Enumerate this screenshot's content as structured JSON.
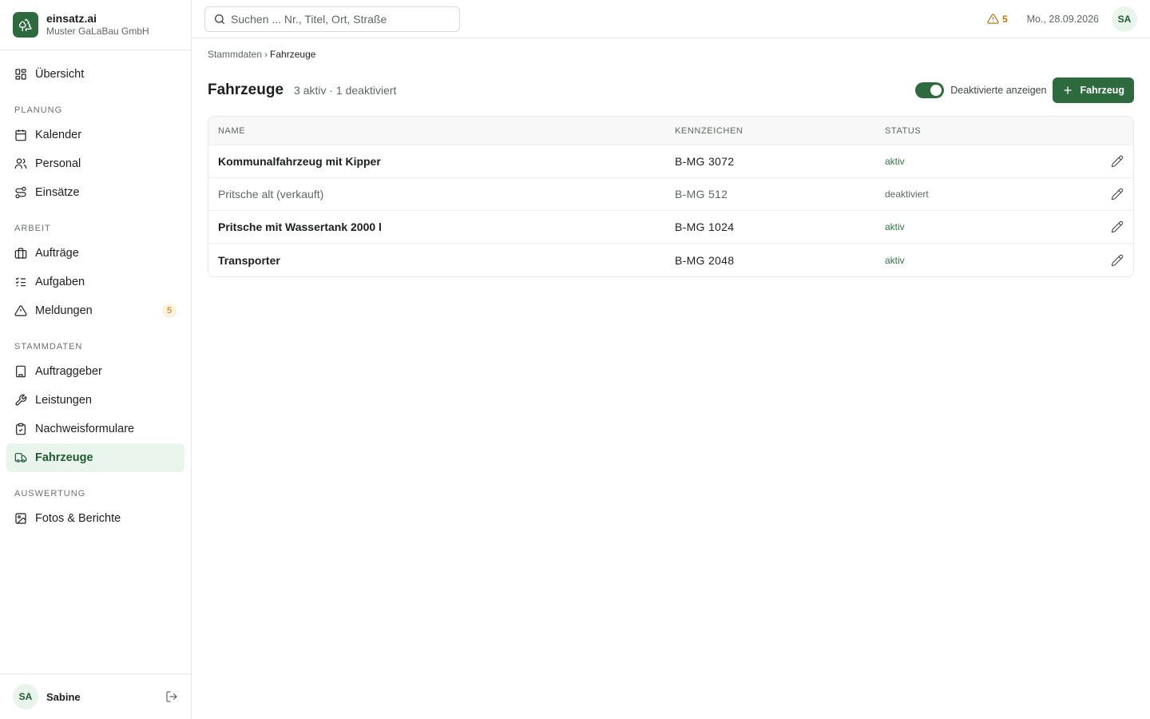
{
  "brand": {
    "name": "einsatz.ai",
    "org": "Muster GaLaBau GmbH",
    "accent": "#2d6a3e"
  },
  "sidebar": {
    "items": [
      {
        "label": "Übersicht",
        "icon": "grid-icon"
      },
      {
        "section": "PLANUNG"
      },
      {
        "label": "Kalender",
        "icon": "calendar-icon"
      },
      {
        "label": "Personal",
        "icon": "users-icon"
      },
      {
        "label": "Einsätze",
        "icon": "route-icon"
      },
      {
        "section": "ARBEIT"
      },
      {
        "label": "Aufträge",
        "icon": "briefcase-icon"
      },
      {
        "label": "Aufgaben",
        "icon": "checklist-icon"
      },
      {
        "label": "Meldungen",
        "icon": "warning-icon",
        "badge": "5"
      },
      {
        "section": "STAMMDATEN"
      },
      {
        "label": "Auftraggeber",
        "icon": "building-icon"
      },
      {
        "label": "Leistungen",
        "icon": "wrench-icon"
      },
      {
        "label": "Nachweisformulare",
        "icon": "clipboard-icon"
      },
      {
        "label": "Fahrzeuge",
        "icon": "truck-icon",
        "active": true
      },
      {
        "section": "AUSWERTUNG"
      },
      {
        "label": "Fotos & Berichte",
        "icon": "image-icon"
      }
    ]
  },
  "user": {
    "initials": "SA",
    "name": "Sabine"
  },
  "header": {
    "search_placeholder": "Suchen ... Nr., Titel, Ort, Straße",
    "alert_count": "5",
    "date": "Mo., 28.09.2026",
    "avatar_initials": "SA"
  },
  "breadcrumb": {
    "parent": "Stammdaten",
    "separator": "›",
    "current": "Fahrzeuge"
  },
  "page": {
    "title": "Fahrzeuge",
    "subtitle": "3 aktiv · 1 deaktiviert",
    "toggle_label": "Deaktivierte anzeigen",
    "toggle_on": true,
    "add_button": "Fahrzeug"
  },
  "table": {
    "columns": [
      "NAME",
      "KENNZEICHEN",
      "STATUS"
    ],
    "rows": [
      {
        "name": "Kommunalfahrzeug mit Kipper",
        "plate": "B-MG 3072",
        "status": "aktiv"
      },
      {
        "name": "Pritsche alt (verkauft)",
        "plate": "B-MG 512",
        "status": "deaktiviert"
      },
      {
        "name": "Pritsche mit Wassertank 2000 l",
        "plate": "B-MG 1024",
        "status": "aktiv"
      },
      {
        "name": "Transporter",
        "plate": "B-MG 2048",
        "status": "aktiv"
      }
    ]
  }
}
